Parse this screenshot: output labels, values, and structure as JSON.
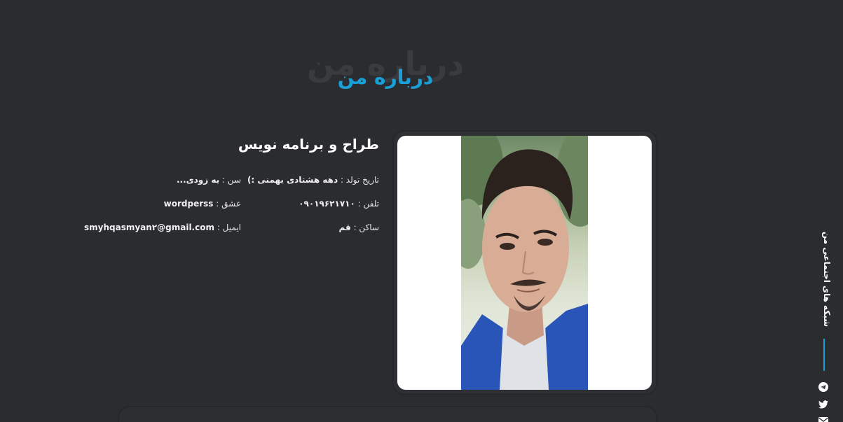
{
  "section": {
    "title_shadow": "درباره من",
    "title": "درباره من"
  },
  "about": {
    "heading": "طراح و برنامه نویس",
    "birth_label": "تاریخ تولد :",
    "birth_value": "دهه هشتادی بهمنی :)",
    "age_label": "سن :",
    "age_value": "به زودی...",
    "phone_label": "تلفن :",
    "phone_value": "۰۹۰۱۹۶۲۱۷۱۰",
    "love_label": "عشق :",
    "love_value": "wordperss",
    "city_label": "ساکن :",
    "city_value": "قم",
    "email_label": "ایمیل :",
    "email_value": "smyhqasmyan۲@gmail.com"
  },
  "social": {
    "label": "شبکه های اجتماعی من",
    "icons": [
      "telegram-icon",
      "twitter-icon",
      "email-icon"
    ]
  },
  "colors": {
    "background": "#2b2c30",
    "accent": "#1aa0d8"
  }
}
